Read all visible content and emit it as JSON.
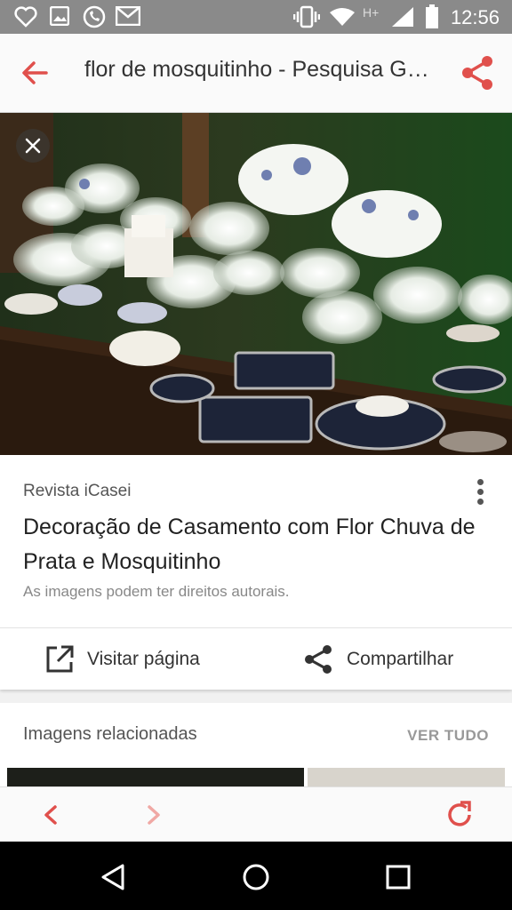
{
  "status_bar": {
    "time": "12:56",
    "network": "H+",
    "icons": [
      "heart-icon",
      "image-icon",
      "whatsapp-icon",
      "gmail-icon",
      "vibrate-icon",
      "wifi-icon",
      "signal-icon",
      "battery-icon"
    ]
  },
  "app_bar": {
    "title": "flor de mosquitinho - Pesquisa Google",
    "back_icon": "arrow-left-icon",
    "share_icon": "share-icon",
    "accent_color": "#e0504c"
  },
  "image_viewer": {
    "close_icon": "close-icon"
  },
  "result": {
    "source": "Revista iCasei",
    "title": "Decoração de Casamento com Flor Chuva de Prata e Mosquitinho",
    "copyright": "As imagens podem ter direitos autorais.",
    "visit_label": "Visitar página",
    "share_label": "Compartilhar"
  },
  "related": {
    "header": "Imagens relacionadas",
    "see_all": "VER TUDO"
  },
  "bottom_bar": {
    "icons": [
      "chevron-left-icon",
      "chevron-right-icon",
      "refresh-icon"
    ]
  },
  "nav_bar": {
    "icons": [
      "nav-back-icon",
      "nav-home-icon",
      "nav-recents-icon"
    ]
  }
}
